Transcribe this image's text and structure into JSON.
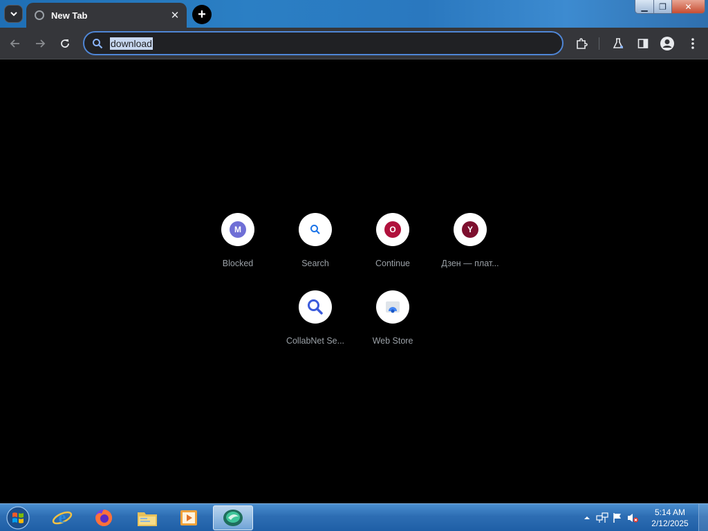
{
  "browser": {
    "tab": {
      "title": "New Tab",
      "close": "✕"
    },
    "new_tab": "+",
    "window_controls": {
      "minimize": "▁",
      "maximize": "❐",
      "close": "✕"
    }
  },
  "toolbar": {
    "omnibox": {
      "value": "download"
    }
  },
  "shortcuts": [
    {
      "label": "Blocked",
      "icon": "letter-m-icon",
      "letter": "M",
      "color": "#6f6fd6"
    },
    {
      "label": "Search",
      "icon": "search-icon",
      "color": "#1a73e8"
    },
    {
      "label": "Continue",
      "icon": "letter-o-icon",
      "letter": "O",
      "color": "#b0113c"
    },
    {
      "label": "Дзен — плат...",
      "icon": "letter-y-icon",
      "letter": "Y",
      "color": "#7d0f2e"
    },
    {
      "label": "CollabNet Se...",
      "icon": "search-icon",
      "color": "#3b5bdb"
    },
    {
      "label": "Web Store",
      "icon": "web-store-icon",
      "color": "#4285f4"
    }
  ],
  "taskbar": {
    "apps": [
      "internet-explorer-icon",
      "firefox-icon",
      "file-explorer-icon",
      "media-player-icon",
      "active-app-icon"
    ],
    "clock": {
      "time": "5:14 AM",
      "date": "2/12/2025"
    }
  }
}
